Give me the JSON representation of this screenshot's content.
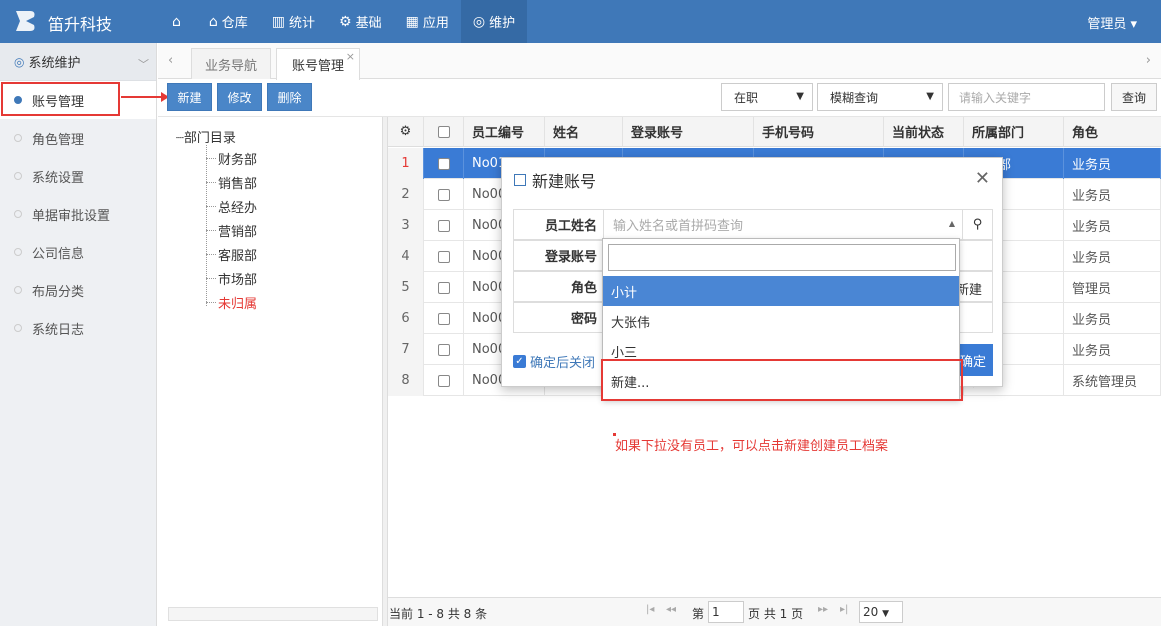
{
  "app": {
    "name": "笛升科技",
    "user": "管理员"
  },
  "nav": [
    {
      "label": "",
      "icon": "home-icon",
      "glyph": "⌂"
    },
    {
      "label": "仓库",
      "icon": "warehouse-icon",
      "glyph": "⌂"
    },
    {
      "label": "统计",
      "icon": "stats-icon",
      "glyph": "▥"
    },
    {
      "label": "基础",
      "icon": "gear-icon",
      "glyph": "⚙"
    },
    {
      "label": "应用",
      "icon": "apps-icon",
      "glyph": "▦"
    },
    {
      "label": "维护",
      "icon": "maintenance-icon",
      "glyph": "◎"
    }
  ],
  "sidebar": {
    "section": "系统维护",
    "items": [
      "账号管理",
      "角色管理",
      "系统设置",
      "单据审批设置",
      "公司信息",
      "布局分类",
      "系统日志"
    ]
  },
  "tabs": [
    "业务导航",
    "账号管理"
  ],
  "toolbar": {
    "new": "新建",
    "edit": "修改",
    "delete": "删除",
    "status": "在职",
    "mode": "模糊查询",
    "search_placeholder": "请输入关键字",
    "query": "查询"
  },
  "tree": {
    "root": "部门目录",
    "items": [
      "财务部",
      "销售部",
      "总经办",
      "营销部",
      "客服部",
      "市场部",
      "未归属"
    ]
  },
  "grid": {
    "headers": [
      "员工编号",
      "姓名",
      "登录账号",
      "手机号码",
      "当前状态",
      "所属部门",
      "角色"
    ],
    "rows": [
      {
        "n": "1",
        "id": "No01",
        "dept": "销售部",
        "role": "业务员"
      },
      {
        "n": "2",
        "id": "No00",
        "dept": "部",
        "role": "业务员"
      },
      {
        "n": "3",
        "id": "No00",
        "dept": "部",
        "role": "业务员"
      },
      {
        "n": "4",
        "id": "No00",
        "dept": "部",
        "role": "业务员"
      },
      {
        "n": "5",
        "id": "No00",
        "dept": "部",
        "role": "管理员"
      },
      {
        "n": "6",
        "id": "No00",
        "dept": "部",
        "role": "业务员"
      },
      {
        "n": "7",
        "id": "No00",
        "dept": "办",
        "role": "业务员"
      },
      {
        "n": "8",
        "id": "No00",
        "dept": "办",
        "role": "系统管理员"
      }
    ]
  },
  "pager": {
    "summary": "当前 1 - 8 共 8 条",
    "page_label": "第",
    "page": "1",
    "total": "页 共 1 页",
    "size": "20"
  },
  "modal": {
    "title": "新建账号",
    "fields": [
      "员工姓名",
      "登录账号",
      "角色",
      "密码"
    ],
    "placeholder": "输入姓名或首拼码查询",
    "role_hint": "新建",
    "close_after": "确定后关闭",
    "ok": "确定"
  },
  "dropdown": {
    "items": [
      "小计",
      "大张伟",
      "小三",
      "新建..."
    ]
  },
  "annotation": "如果下拉没有员工，可以点击新建创建员工档案"
}
